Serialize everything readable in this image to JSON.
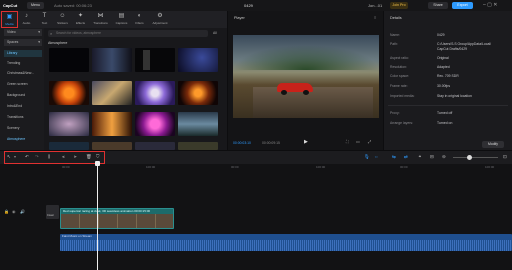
{
  "app": {
    "name": "CapCut",
    "menu_label": "Menu",
    "autosave": "Auto saved: 00:06:23",
    "project_title": "0429",
    "user": "Jon...01",
    "join_pro": "Join Pro",
    "share": "Share",
    "export": "Export"
  },
  "toolbar": {
    "items": [
      {
        "label": "Media",
        "icon": "media-icon"
      },
      {
        "label": "Audio",
        "icon": "audio-icon"
      },
      {
        "label": "Text",
        "icon": "text-icon"
      },
      {
        "label": "Stickers",
        "icon": "stickers-icon"
      },
      {
        "label": "Effects",
        "icon": "effects-icon"
      },
      {
        "label": "Transitions",
        "icon": "transitions-icon"
      },
      {
        "label": "Captions",
        "icon": "captions-icon"
      },
      {
        "label": "Filters",
        "icon": "filters-icon"
      },
      {
        "label": "Adjustment",
        "icon": "adjustment-icon"
      }
    ]
  },
  "categories": {
    "dropdowns": [
      "Video",
      "Spaces"
    ],
    "items": [
      "Library",
      "Trending",
      "Christmas&New...",
      "Green screen",
      "Background",
      "Intro&End",
      "Transitions",
      "Scenery",
      "Atmosphere"
    ],
    "active": "Atmosphere"
  },
  "library": {
    "search_placeholder": "Search for videos, atmosphere",
    "filter_label": "All",
    "section_title": "Atmosphere"
  },
  "player": {
    "title": "Player",
    "time_current": "00:00:03:10",
    "time_total": "00:00:09:15"
  },
  "details": {
    "title": "Details",
    "rows": [
      {
        "k": "Name:",
        "v": "0429"
      },
      {
        "k": "Path:",
        "v": "C:/Users/S.S Group/AppData/Local/"
      },
      {
        "k": "",
        "v": "CapCut Drafts/0429"
      },
      {
        "k": "Aspect ratio:",
        "v": "Original"
      },
      {
        "k": "Resolution:",
        "v": "Adapted"
      },
      {
        "k": "Color space:",
        "v": "Rec. 709 SDR"
      },
      {
        "k": "Frame rate:",
        "v": "30.00fps"
      },
      {
        "k": "Imported media:",
        "v": "Stay in original location"
      },
      {
        "k": "Proxy:",
        "v": "Turned off"
      },
      {
        "k": "Arrange layers:",
        "v": "Turned on"
      }
    ],
    "modify": "Modify"
  },
  "timeline": {
    "ticks": [
      "00:00",
      "100:00",
      "00:00",
      "100:00",
      "00:00",
      "100:00"
    ],
    "video_clip": "Red supercar racing at dusk, 3D seamless animation  00:00:15:00",
    "cover_label": "Cover",
    "audio_clip": "Faint Music on Stream"
  },
  "colors": {
    "accent": "#2e9bff",
    "red": "#e03131",
    "video_clip": "#1d6b6b",
    "audio_clip": "#1f4f8f"
  }
}
